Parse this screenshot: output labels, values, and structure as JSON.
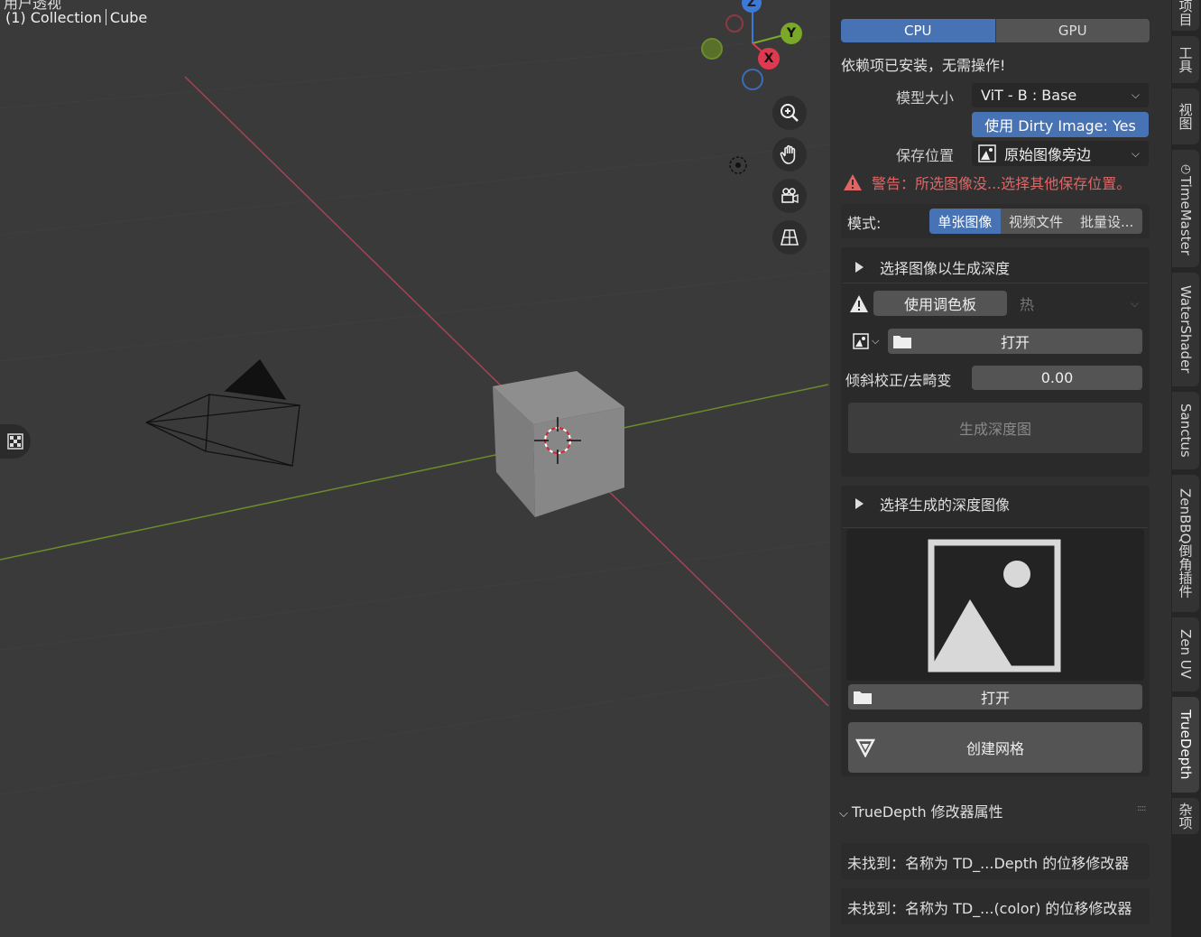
{
  "viewport": {
    "top_cut_text": "用户透视",
    "collection_label": "(1) Collection",
    "object_label": "Cube",
    "gizmo": {
      "z": "Z",
      "y": "Y",
      "x": "X"
    },
    "nav_icons": [
      "zoom-icon",
      "hand-pan-icon",
      "camera-icon",
      "perspective-grid-icon"
    ]
  },
  "panel": {
    "device": {
      "options": [
        "CPU",
        "GPU"
      ],
      "selected": "CPU"
    },
    "deps_status": "依赖项已安装，无需操作!",
    "model_size": {
      "label": "模型大小",
      "value": "ViT - B : Base"
    },
    "dirty_image_button": "使用 Dirty Image: Yes",
    "save_location": {
      "label": "保存位置",
      "value": "原始图像旁边"
    },
    "warning_text": "警告：所选图像没...选择其他保存位置。",
    "mode": {
      "label": "模式:",
      "options": [
        "单张图像",
        "视频文件",
        "批量设..."
      ],
      "selected": "单张图像"
    },
    "section1": {
      "title": "选择图像以生成深度",
      "palette_button": "使用调色板",
      "palette_value": "热",
      "open_label": "打开",
      "tilt": {
        "label": "倾斜校正/去畸变",
        "value": "0.00"
      },
      "generate_button": "生成深度图"
    },
    "section2": {
      "title": "选择生成的深度图像",
      "open_label": "打开",
      "create_mesh_button": "创建网格"
    },
    "modifier_panel": {
      "title": "TrueDepth 修改器属性",
      "msg1": "未找到：名称为 TD_...Depth 的位移修改器",
      "msg2": "未找到：名称为 TD_...(color) 的位移修改器"
    }
  },
  "sidebar_tabs": [
    "项目",
    "工具",
    "视图",
    "TimeMaster",
    "WaterShader",
    "Sanctus",
    "ZenBBQ倒角插件",
    "Zen UV",
    "TrueDepth",
    "杂项"
  ],
  "active_tab": "TrueDepth",
  "colors": {
    "accent": "#4772b3",
    "warning": "#e06666",
    "x_axis": "#e0394f",
    "y_axis": "#7aa828",
    "z_axis": "#3d7ad8"
  }
}
